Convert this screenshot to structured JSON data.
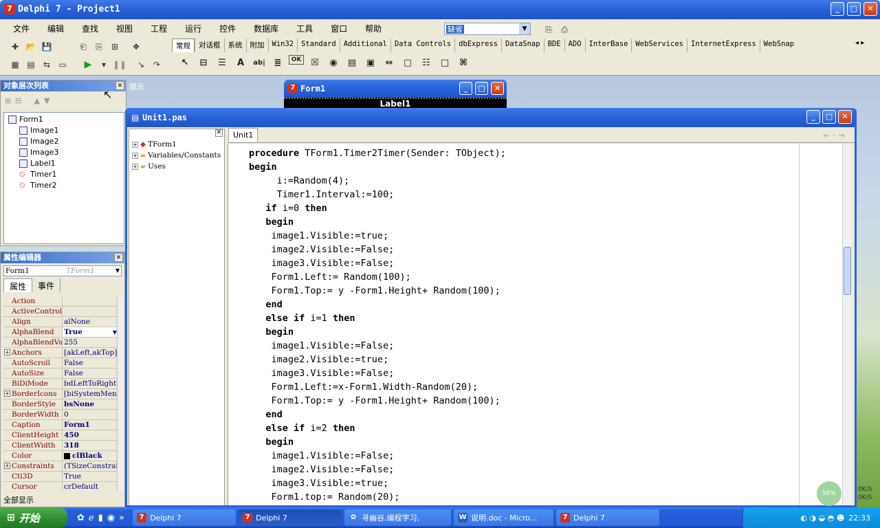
{
  "main": {
    "title": "Delphi 7 - Project1",
    "menu": [
      "文件",
      "编辑",
      "查找",
      "视图",
      "工程",
      "运行",
      "控件",
      "数据库",
      "工具",
      "窗口",
      "帮助"
    ],
    "layout_combo": "缺省",
    "palette_tabs": [
      "常规",
      "对话框",
      "系统",
      "附加",
      "Win32",
      "Standard",
      "Additional",
      "Data Controls",
      "dbExpress",
      "DataSnap",
      "BDE",
      "ADO",
      "InterBase",
      "WebServices",
      "InternetExpress",
      "WebSnap"
    ]
  },
  "tree_view": {
    "title": "对象层次列表",
    "nodes": [
      "Form1",
      "Image1",
      "Image2",
      "Image3",
      "Label1",
      "Timer1",
      "Timer2"
    ],
    "hint_text": "提示"
  },
  "inspector": {
    "title": "属性编辑器",
    "object": "Form1",
    "object_type": "TForm1",
    "tabs": [
      "属性",
      "事件"
    ],
    "footer": "全部显示",
    "props": [
      {
        "k": "Action",
        "v": ""
      },
      {
        "k": "ActiveControl",
        "v": ""
      },
      {
        "k": "Align",
        "v": "alNone"
      },
      {
        "k": "AlphaBlend",
        "v": "True"
      },
      {
        "k": "AlphaBlendValue",
        "v": "255"
      },
      {
        "k": "Anchors",
        "v": "[akLeft,akTop]"
      },
      {
        "k": "AutoScroll",
        "v": "False"
      },
      {
        "k": "AutoSize",
        "v": "False"
      },
      {
        "k": "BiDiMode",
        "v": "bdLeftToRight"
      },
      {
        "k": "BorderIcons",
        "v": "[biSystemMenu]"
      },
      {
        "k": "BorderStyle",
        "v": "bsNone"
      },
      {
        "k": "BorderWidth",
        "v": "0"
      },
      {
        "k": "Caption",
        "v": "Form1"
      },
      {
        "k": "ClientHeight",
        "v": "450"
      },
      {
        "k": "ClientWidth",
        "v": "318"
      },
      {
        "k": "Color",
        "v": "clBlack"
      },
      {
        "k": "Constraints",
        "v": "(TSizeConstraints)"
      },
      {
        "k": "Ctl3D",
        "v": "True"
      },
      {
        "k": "Cursor",
        "v": "crDefault"
      }
    ]
  },
  "form1": {
    "title": "Form1",
    "label": "Label1"
  },
  "editor": {
    "title": "Unit1.pas",
    "tab": "Unit1",
    "explorer": [
      "TForm1",
      "Variables/Constants",
      "Uses"
    ],
    "lines": [
      [
        [
          "kw",
          "procedure"
        ],
        [
          "t",
          " TForm1.Timer2Timer(Sender: TObject);"
        ]
      ],
      [
        [
          "kw",
          "begin"
        ]
      ],
      [
        [
          "t",
          "     i:=Random(4);"
        ]
      ],
      [
        [
          "t",
          "     Timer1.Interval:=100;"
        ]
      ],
      [
        [
          "t",
          "   "
        ],
        [
          "kw",
          "if"
        ],
        [
          "t",
          " i=0 "
        ],
        [
          "kw",
          "then"
        ]
      ],
      [
        [
          "t",
          "   "
        ],
        [
          "kw",
          "begin"
        ]
      ],
      [
        [
          "t",
          "    image1.Visible:=true;"
        ]
      ],
      [
        [
          "t",
          "    image2.Visible:=False;"
        ]
      ],
      [
        [
          "t",
          "    image3.Visible:=False;"
        ]
      ],
      [
        [
          "t",
          "    Form1.Left:= Random(100);"
        ]
      ],
      [
        [
          "t",
          "    Form1.Top:= y -Form1.Height+ Random(100);"
        ]
      ],
      [
        [
          "t",
          "   "
        ],
        [
          "kw",
          "end"
        ]
      ],
      [
        [
          "t",
          "   "
        ],
        [
          "kw",
          "else if"
        ],
        [
          "t",
          " i=1 "
        ],
        [
          "kw",
          "then"
        ]
      ],
      [
        [
          "t",
          "   "
        ],
        [
          "kw",
          "begin"
        ]
      ],
      [
        [
          "t",
          "    image1.Visible:=False;"
        ]
      ],
      [
        [
          "t",
          "    image2.Visible:=true;"
        ]
      ],
      [
        [
          "t",
          "    image3.Visible:=False;"
        ]
      ],
      [
        [
          "t",
          "    Form1.Left:=x-Form1.Width-Random(20);"
        ]
      ],
      [
        [
          "t",
          "    Form1.Top:= y -Form1.Height+ Random(100);"
        ]
      ],
      [
        [
          "t",
          "   "
        ],
        [
          "kw",
          "end"
        ]
      ],
      [
        [
          "t",
          "   "
        ],
        [
          "kw",
          "else if"
        ],
        [
          "t",
          " i=2 "
        ],
        [
          "kw",
          "then"
        ]
      ],
      [
        [
          "t",
          "   "
        ],
        [
          "kw",
          "begin"
        ]
      ],
      [
        [
          "t",
          "    image1.Visible:=False;"
        ]
      ],
      [
        [
          "t",
          "    image2.Visible:=False;"
        ]
      ],
      [
        [
          "t",
          "    image3.Visible:=true;"
        ]
      ],
      [
        [
          "t",
          "    Form1.top:= Random(20);"
        ]
      ]
    ]
  },
  "taskbar": {
    "start": "开始",
    "tasks": [
      "Delphi 7",
      "Delphi 7",
      "寻幽谷,编程学习,",
      "说明.doc - Micro...",
      "Delphi 7"
    ],
    "clock": "22:33",
    "net_percent": "50%",
    "net_up": "0K/S",
    "net_down": "0K/S"
  },
  "colors": {
    "xp_blue": "#2a62d8",
    "keyword": "#000000",
    "prop_name": "#800000",
    "prop_value": "#000080"
  }
}
